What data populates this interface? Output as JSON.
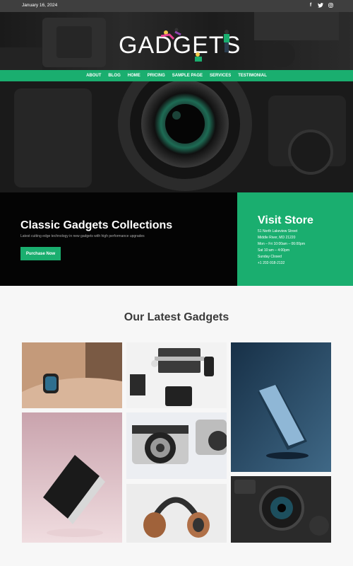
{
  "topbar": {
    "date": "January 16, 2024",
    "social": [
      "facebook-icon",
      "twitter-icon",
      "instagram-icon"
    ]
  },
  "header": {
    "logo_text": "GADGETS"
  },
  "nav": {
    "items": [
      "ABOUT",
      "BLOG",
      "HOME",
      "PRICING",
      "SAMPLE PAGE",
      "SERVICES",
      "TESTIMONIAL"
    ]
  },
  "promo": {
    "title": "Classic Gadgets Collections",
    "subtitle": "Latest cutting edge technology in new gadgets with high performance upgrades",
    "button_label": "Purchase Now"
  },
  "store": {
    "title": "Visit Store",
    "lines": [
      "51 North Lakeview Street",
      "Middle River, MD 21220",
      "Mon – Fri 10:00am – 06:00pm",
      "Sat 10:am – 4:00pm",
      "Sunday Closed",
      "+1 202-918-2132"
    ]
  },
  "gallery": {
    "title": "Our Latest Gadgets"
  },
  "colors": {
    "accent": "#1aae6f",
    "topbar": "#3f3f3f",
    "dark": "#040404"
  }
}
